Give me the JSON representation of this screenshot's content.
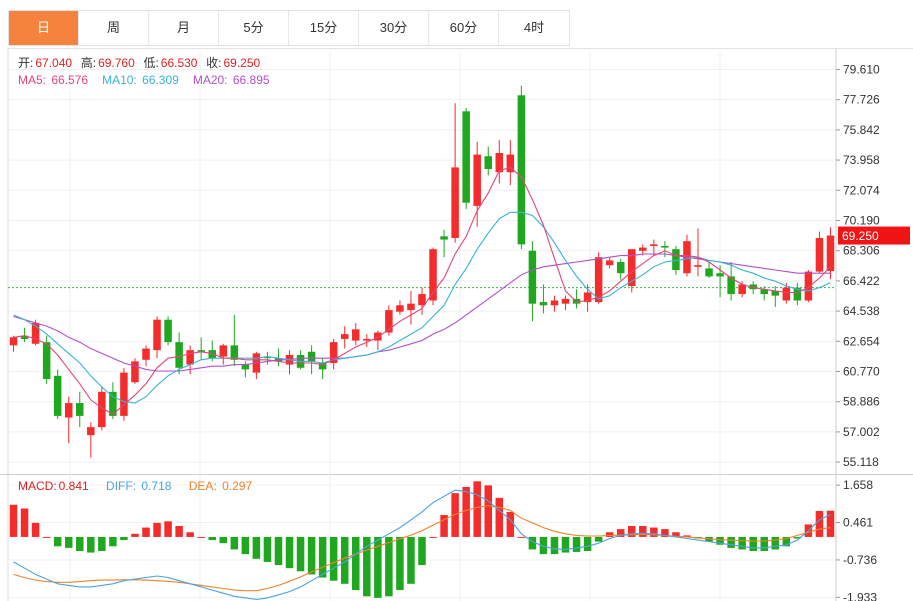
{
  "tabs": [
    "日",
    "周",
    "月",
    "5分",
    "15分",
    "30分",
    "60分",
    "4时"
  ],
  "active_tab": 0,
  "ohlc": {
    "open_label": "开:",
    "open": "67.040",
    "high_label": "高:",
    "high": "69.760",
    "low_label": "低:",
    "low": "66.530",
    "close_label": "收:",
    "close": "69.250"
  },
  "ma": {
    "ma5_label": "MA5:",
    "ma5": "66.576",
    "ma10_label": "MA10:",
    "ma10": "66.309",
    "ma20_label": "MA20:",
    "ma20": "66.895"
  },
  "macd_legend": {
    "macd_label": "MACD:",
    "macd": "0.841",
    "diff_label": "DIFF:",
    "diff": "0.718",
    "dea_label": "DEA:",
    "dea": "0.297"
  },
  "price_badge": "69.250",
  "colors": {
    "up": "#f52c2c",
    "down": "#1fa81f",
    "ma5": "#e4457b",
    "ma10": "#38b3d6",
    "ma20": "#b44fc9",
    "diff": "#4ca3e0",
    "dea": "#f0822c",
    "active_tab": "#f5833d",
    "grid": "#eef0f2"
  },
  "chart_data": [
    {
      "type": "candlestick",
      "ylim": [
        54.5,
        80.7
      ],
      "yticks": [
        "79.610",
        "77.726",
        "75.842",
        "73.958",
        "72.074",
        "70.190",
        "68.306",
        "66.422",
        "64.538",
        "62.654",
        "60.770",
        "58.886",
        "57.002",
        "55.118"
      ],
      "ytick_values": [
        79.61,
        77.726,
        75.842,
        73.958,
        72.074,
        70.19,
        68.306,
        66.422,
        64.538,
        62.654,
        60.77,
        58.886,
        57.002,
        55.118
      ],
      "reference_line": 66.0,
      "candles": [
        [
          62.4,
          63.0,
          62.0,
          62.9
        ],
        [
          63.0,
          63.5,
          62.6,
          62.8
        ],
        [
          62.5,
          64.0,
          62.4,
          63.8
        ],
        [
          62.6,
          63.0,
          60.0,
          60.3
        ],
        [
          60.5,
          60.9,
          57.8,
          58.0
        ],
        [
          57.9,
          59.2,
          56.3,
          58.8
        ],
        [
          58.8,
          59.5,
          57.3,
          58.0
        ],
        [
          56.8,
          57.6,
          55.4,
          57.3
        ],
        [
          57.3,
          59.8,
          57.1,
          59.5
        ],
        [
          59.5,
          60.1,
          57.8,
          58.0
        ],
        [
          58.0,
          61.0,
          57.7,
          60.7
        ],
        [
          60.1,
          61.6,
          60.0,
          61.4
        ],
        [
          61.5,
          62.4,
          61.1,
          62.2
        ],
        [
          62.1,
          64.2,
          61.6,
          64.0
        ],
        [
          64.0,
          64.2,
          62.4,
          62.6
        ],
        [
          62.6,
          63.2,
          60.6,
          61.0
        ],
        [
          61.2,
          62.4,
          60.6,
          62.1
        ],
        [
          62.1,
          62.9,
          61.5,
          62.0
        ],
        [
          62.1,
          62.7,
          61.4,
          61.6
        ],
        [
          61.7,
          62.5,
          61.2,
          62.4
        ],
        [
          62.4,
          64.3,
          61.1,
          61.5
        ],
        [
          61.2,
          61.4,
          60.4,
          60.9
        ],
        [
          60.7,
          62.0,
          60.3,
          61.9
        ],
        [
          61.7,
          62.0,
          61.2,
          61.6
        ],
        [
          61.6,
          62.2,
          61.1,
          61.4
        ],
        [
          61.2,
          62.1,
          60.6,
          61.8
        ],
        [
          61.8,
          62.1,
          60.9,
          61.0
        ],
        [
          62.0,
          62.4,
          60.6,
          61.4
        ],
        [
          61.3,
          61.6,
          60.3,
          60.9
        ],
        [
          61.3,
          62.8,
          60.9,
          62.6
        ],
        [
          62.8,
          63.6,
          62.2,
          63.1
        ],
        [
          62.7,
          63.8,
          62.4,
          63.4
        ],
        [
          62.7,
          63.1,
          62.3,
          62.8
        ],
        [
          62.7,
          63.3,
          62.1,
          63.2
        ],
        [
          63.2,
          64.9,
          63.0,
          64.6
        ],
        [
          64.5,
          65.2,
          64.3,
          64.9
        ],
        [
          64.6,
          65.8,
          63.7,
          65.0
        ],
        [
          64.9,
          66.0,
          64.3,
          65.6
        ],
        [
          65.2,
          68.5,
          64.9,
          68.4
        ],
        [
          69.2,
          69.6,
          67.9,
          69.0
        ],
        [
          69.1,
          77.5,
          68.8,
          73.5
        ],
        [
          77.0,
          77.2,
          70.9,
          71.3
        ],
        [
          71.1,
          75.1,
          69.8,
          74.3
        ],
        [
          74.2,
          74.8,
          73.0,
          73.4
        ],
        [
          73.2,
          75.2,
          72.5,
          74.4
        ],
        [
          73.2,
          75.2,
          72.4,
          74.3
        ],
        [
          78.0,
          78.6,
          68.4,
          68.7
        ],
        [
          68.3,
          68.9,
          63.9,
          65.0
        ],
        [
          65.1,
          66.2,
          64.4,
          64.9
        ],
        [
          64.9,
          65.5,
          64.5,
          65.2
        ],
        [
          65.0,
          65.5,
          64.6,
          65.3
        ],
        [
          65.3,
          65.9,
          64.7,
          65.0
        ],
        [
          65.1,
          66.2,
          64.5,
          65.7
        ],
        [
          65.1,
          68.2,
          65.0,
          67.9
        ],
        [
          67.4,
          67.9,
          67.2,
          67.7
        ],
        [
          67.6,
          67.8,
          66.5,
          66.9
        ],
        [
          66.1,
          68.3,
          65.7,
          68.4
        ],
        [
          68.3,
          68.7,
          68.0,
          68.5
        ],
        [
          68.6,
          69.0,
          68.0,
          68.7
        ],
        [
          68.6,
          68.9,
          67.9,
          68.5
        ],
        [
          68.4,
          68.6,
          66.8,
          67.1
        ],
        [
          66.9,
          69.3,
          66.7,
          68.9
        ],
        [
          67.3,
          69.7,
          66.7,
          67.4
        ],
        [
          67.2,
          67.6,
          66.6,
          66.7
        ],
        [
          66.9,
          67.4,
          65.4,
          66.7
        ],
        [
          66.7,
          67.6,
          65.2,
          65.6
        ],
        [
          65.6,
          66.4,
          65.4,
          66.2
        ],
        [
          66.2,
          66.4,
          65.6,
          65.9
        ],
        [
          65.9,
          66.1,
          65.2,
          65.6
        ],
        [
          65.8,
          66.1,
          64.8,
          65.5
        ],
        [
          65.2,
          66.3,
          65.0,
          66.0
        ],
        [
          66.0,
          66.3,
          64.9,
          65.2
        ],
        [
          65.2,
          67.1,
          65.1,
          67.0
        ],
        [
          67.0,
          69.5,
          66.9,
          69.1
        ],
        [
          67.04,
          69.76,
          66.53,
          69.25
        ]
      ],
      "ma5": [
        62.9,
        63.0,
        62.8,
        62.5,
        61.8,
        60.9,
        60.0,
        59.0,
        58.5,
        58.1,
        58.7,
        59.3,
        60.0,
        61.0,
        61.6,
        61.7,
        61.9,
        62.0,
        61.9,
        61.6,
        61.6,
        61.5,
        61.5,
        61.5,
        61.4,
        61.3,
        61.3,
        61.3,
        61.2,
        61.5,
        61.9,
        62.3,
        62.6,
        62.9,
        63.4,
        63.9,
        64.3,
        64.7,
        65.7,
        66.6,
        68.1,
        69.2,
        70.8,
        71.9,
        73.3,
        73.5,
        72.9,
        71.5,
        69.9,
        67.8,
        65.8,
        65.1,
        65.2,
        65.4,
        65.8,
        66.4,
        67.0,
        67.5,
        68.0,
        68.3,
        68.0,
        68.0,
        67.9,
        67.6,
        67.1,
        66.6,
        66.2,
        66.0,
        65.9,
        65.8,
        65.7,
        65.7,
        66.0,
        66.6,
        67.3
      ],
      "ma10": [
        64.3,
        64.0,
        63.6,
        63.1,
        62.5,
        61.9,
        61.3,
        60.5,
        59.8,
        59.2,
        58.9,
        58.8,
        59.2,
        59.9,
        60.5,
        60.9,
        61.2,
        61.5,
        61.6,
        61.6,
        61.6,
        61.6,
        61.6,
        61.7,
        61.6,
        61.5,
        61.4,
        61.4,
        61.3,
        61.5,
        61.6,
        61.7,
        61.8,
        62.0,
        62.3,
        62.7,
        63.1,
        63.5,
        64.2,
        64.9,
        66.2,
        67.2,
        68.4,
        69.4,
        70.3,
        70.7,
        70.7,
        70.5,
        69.8,
        68.8,
        67.7,
        66.7,
        65.9,
        65.3,
        65.5,
        66.0,
        66.4,
        66.8,
        67.3,
        67.6,
        67.7,
        67.8,
        67.9,
        67.7,
        67.6,
        67.4,
        67.1,
        66.9,
        66.6,
        66.4,
        66.1,
        65.9,
        65.8,
        66.0,
        66.3
      ],
      "ma20": [
        64.2,
        64.0,
        63.8,
        63.6,
        63.3,
        62.9,
        62.6,
        62.2,
        61.9,
        61.6,
        61.3,
        61.1,
        60.9,
        60.8,
        60.8,
        60.8,
        60.9,
        61.0,
        61.1,
        61.1,
        61.2,
        61.2,
        61.3,
        61.4,
        61.5,
        61.5,
        61.6,
        61.6,
        61.6,
        61.6,
        61.6,
        61.7,
        61.8,
        62.0,
        62.1,
        62.3,
        62.5,
        62.7,
        63.1,
        63.4,
        63.8,
        64.3,
        64.8,
        65.3,
        65.8,
        66.3,
        66.8,
        67.1,
        67.3,
        67.4,
        67.5,
        67.6,
        67.7,
        67.8,
        67.9,
        68.0,
        68.0,
        68.1,
        68.1,
        68.1,
        68.0,
        67.9,
        67.8,
        67.7,
        67.6,
        67.5,
        67.4,
        67.3,
        67.2,
        67.1,
        67.0,
        66.9,
        66.9,
        66.9,
        66.9
      ]
    },
    {
      "type": "macd",
      "ylim": [
        -2.05,
        1.95
      ],
      "yticks": [
        "1.658",
        "0.461",
        "-0.736",
        "-1.933"
      ],
      "ytick_values": [
        1.658,
        0.461,
        -0.736,
        -1.933
      ],
      "macd": [
        1.03,
        0.91,
        0.45,
        0.0,
        -0.3,
        -0.35,
        -0.45,
        -0.5,
        -0.45,
        -0.3,
        -0.1,
        0.1,
        0.3,
        0.45,
        0.5,
        0.35,
        0.15,
        0.0,
        -0.1,
        -0.2,
        -0.4,
        -0.55,
        -0.7,
        -0.8,
        -0.9,
        -1.0,
        -1.1,
        -1.2,
        -1.3,
        -1.4,
        -1.5,
        -1.7,
        -1.9,
        -1.95,
        -1.9,
        -1.7,
        -1.5,
        -0.9,
        0.0,
        0.7,
        1.4,
        1.6,
        1.78,
        1.65,
        1.25,
        0.8,
        0.0,
        -0.4,
        -0.55,
        -0.55,
        -0.5,
        -0.48,
        -0.45,
        -0.15,
        0.15,
        0.25,
        0.35,
        0.35,
        0.3,
        0.25,
        0.15,
        0.05,
        -0.05,
        -0.15,
        -0.25,
        -0.35,
        -0.4,
        -0.45,
        -0.45,
        -0.4,
        -0.3,
        -0.05,
        0.4,
        0.83,
        0.841
      ],
      "diff": [
        -0.8,
        -1.0,
        -1.2,
        -1.35,
        -1.5,
        -1.55,
        -1.6,
        -1.6,
        -1.55,
        -1.5,
        -1.4,
        -1.35,
        -1.3,
        -1.25,
        -1.3,
        -1.4,
        -1.5,
        -1.6,
        -1.7,
        -1.8,
        -1.9,
        -1.95,
        -2.0,
        -1.95,
        -1.85,
        -1.75,
        -1.6,
        -1.4,
        -1.2,
        -1.0,
        -0.8,
        -0.55,
        -0.3,
        -0.1,
        0.1,
        0.3,
        0.55,
        0.8,
        1.1,
        1.3,
        1.5,
        1.45,
        1.35,
        1.15,
        0.85,
        0.55,
        0.1,
        -0.15,
        -0.3,
        -0.38,
        -0.4,
        -0.35,
        -0.3,
        -0.2,
        -0.05,
        0.05,
        0.1,
        0.12,
        0.1,
        0.05,
        0.0,
        -0.05,
        -0.1,
        -0.15,
        -0.2,
        -0.25,
        -0.3,
        -0.35,
        -0.35,
        -0.3,
        -0.25,
        -0.1,
        0.2,
        0.55,
        0.718
      ],
      "dea": [
        -1.2,
        -1.3,
        -1.38,
        -1.43,
        -1.45,
        -1.45,
        -1.43,
        -1.4,
        -1.38,
        -1.38,
        -1.37,
        -1.37,
        -1.38,
        -1.4,
        -1.42,
        -1.45,
        -1.5,
        -1.55,
        -1.6,
        -1.65,
        -1.7,
        -1.72,
        -1.72,
        -1.65,
        -1.55,
        -1.42,
        -1.28,
        -1.12,
        -0.97,
        -0.82,
        -0.68,
        -0.55,
        -0.42,
        -0.3,
        -0.18,
        -0.06,
        0.06,
        0.2,
        0.38,
        0.55,
        0.72,
        0.85,
        0.95,
        1.0,
        0.95,
        0.85,
        0.6,
        0.45,
        0.3,
        0.18,
        0.1,
        0.05,
        0.03,
        0.03,
        0.05,
        0.06,
        0.07,
        0.08,
        0.07,
        0.05,
        0.02,
        0.0,
        -0.03,
        -0.06,
        -0.09,
        -0.1,
        -0.12,
        -0.13,
        -0.13,
        -0.1,
        -0.05,
        0.05,
        0.15,
        0.25,
        0.297
      ]
    }
  ]
}
